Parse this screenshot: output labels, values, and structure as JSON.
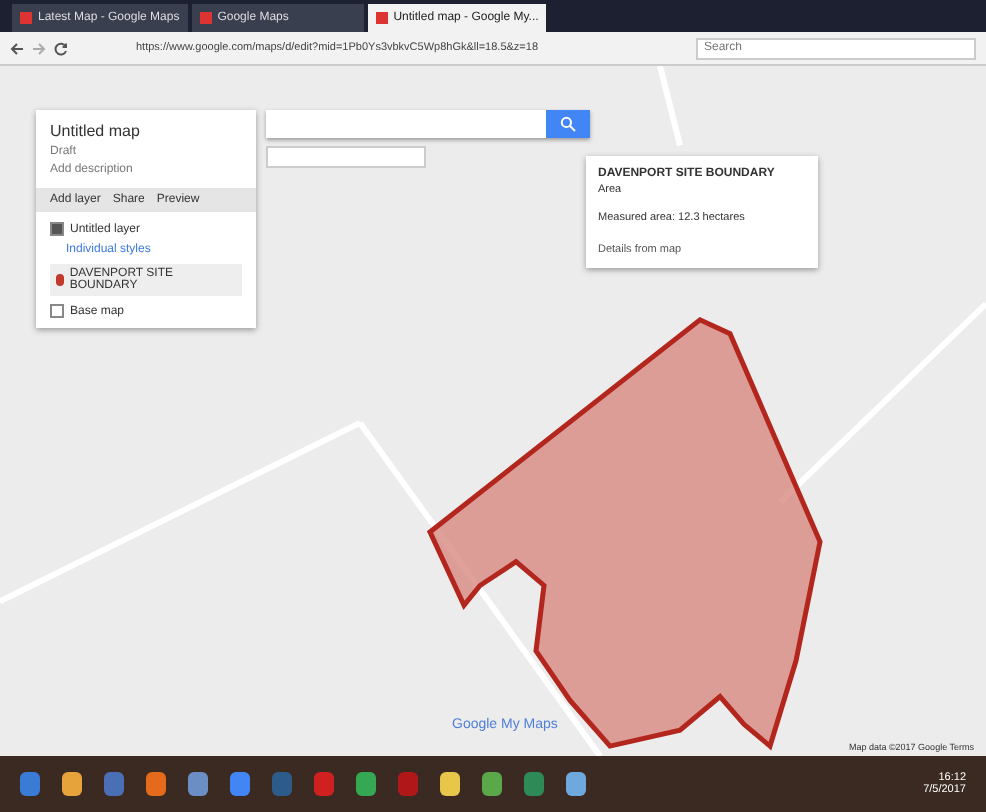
{
  "browser": {
    "tabs": [
      {
        "title": "Latest Map - Google Maps",
        "selected": false
      },
      {
        "title": "Google Maps",
        "selected": false
      },
      {
        "title": "Untitled map - Google My...",
        "selected": true
      }
    ],
    "url": "https://www.google.com/maps/d/edit?mid=1Pb0Ys3vbkvC5Wp8hGk&ll=18.5&z=18",
    "search_placeholder": "Search"
  },
  "panel": {
    "title": "Untitled map",
    "subtitle": "Draft",
    "description": "Add description",
    "actions": [
      "Add layer",
      "Share",
      "Preview"
    ],
    "layer": {
      "name": "Untitled layer",
      "checked": true,
      "style_link": "Individual styles",
      "items": [
        {
          "name": "DAVENPORT SITE BOUNDARY",
          "color": "#c0392b"
        }
      ]
    },
    "base_map": {
      "label": "Base map",
      "checked": false
    }
  },
  "popup": {
    "title": "DAVENPORT SITE BOUNDARY",
    "subtitle": "Area",
    "description": "Measured area: 12.3 hectares",
    "footer": "Details from map"
  },
  "map_footer": "Google My Maps",
  "attribution": "Map data ©2017 Google  Terms",
  "taskbar": {
    "time": "16:12",
    "date": "7/5/2017"
  }
}
